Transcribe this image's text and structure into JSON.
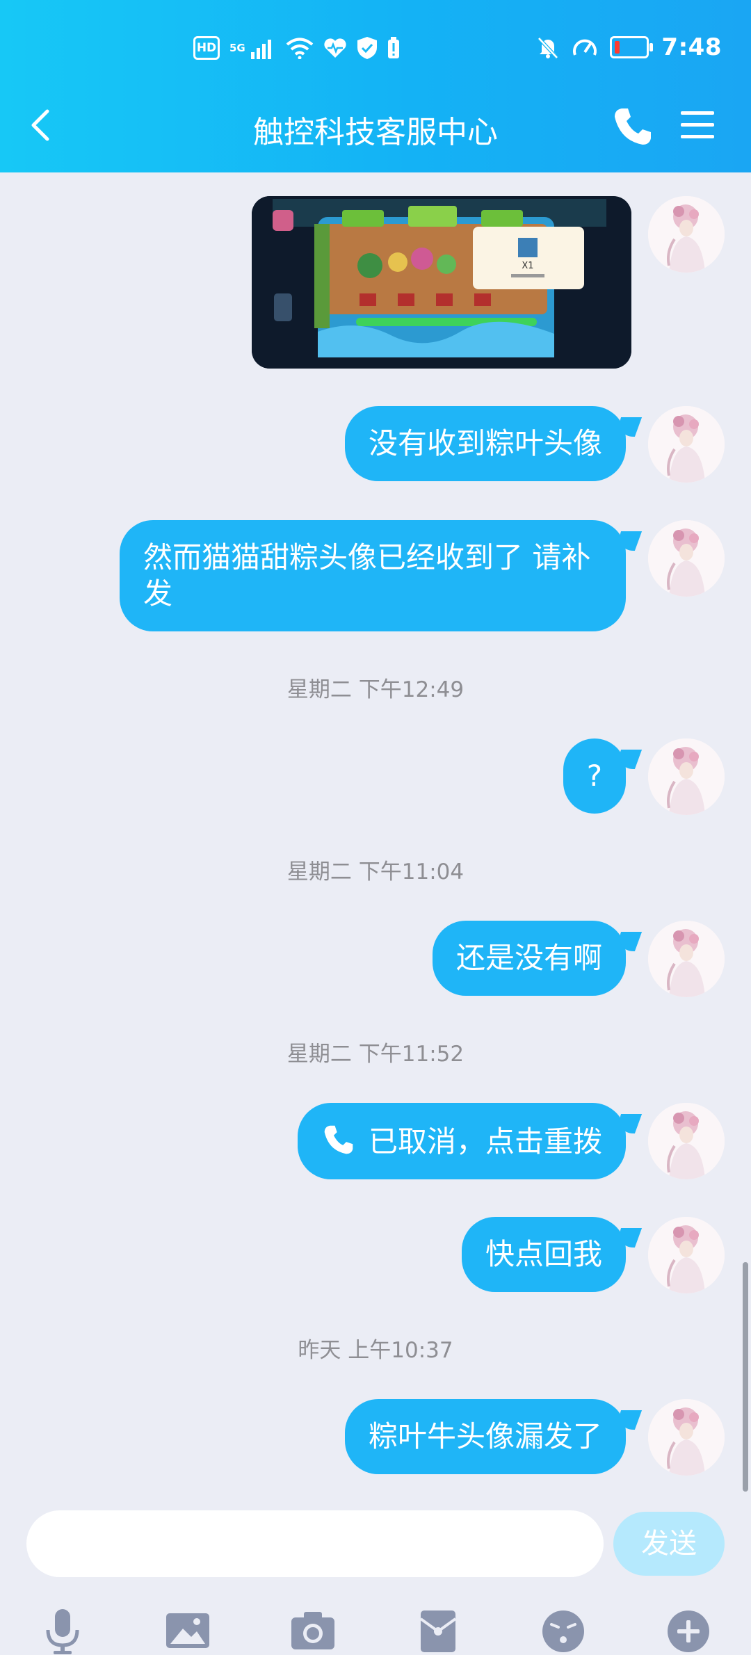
{
  "status_bar": {
    "hd": "HD",
    "network": "5G",
    "time": "7:48"
  },
  "header": {
    "title": "触控科技客服中心",
    "back_icon": "chevron-left-icon",
    "call_icon": "phone-icon",
    "menu_icon": "menu-icon"
  },
  "messages": [
    {
      "type": "image",
      "caption": "X1"
    },
    {
      "type": "text",
      "text": "没有收到粽叶头像"
    },
    {
      "type": "text",
      "text": "然而猫猫甜粽头像已经收到了 请补发"
    },
    {
      "type": "timestamp",
      "text": "星期二 下午12:49"
    },
    {
      "type": "text",
      "text": "?"
    },
    {
      "type": "timestamp",
      "text": "星期二 下午11:04"
    },
    {
      "type": "text",
      "text": "还是没有啊"
    },
    {
      "type": "timestamp",
      "text": "星期二 下午11:52"
    },
    {
      "type": "call",
      "text": "已取消，点击重拨"
    },
    {
      "type": "text",
      "text": "快点回我"
    },
    {
      "type": "timestamp",
      "text": "昨天 上午10:37"
    },
    {
      "type": "text",
      "text": "粽叶牛头像漏发了"
    }
  ],
  "input": {
    "placeholder": "",
    "send_label": "发送"
  },
  "toolbar": [
    "microphone-icon",
    "image-icon",
    "camera-icon",
    "red-packet-icon",
    "emoji-icon",
    "plus-icon"
  ],
  "colors": {
    "header_start": "#17c8f6",
    "header_end": "#1aa6f3",
    "bubble": "#1fb5f7",
    "background": "#ebedf5",
    "send_disabled": "#b5e9fd",
    "toolbar_icon": "#8a94ad"
  }
}
